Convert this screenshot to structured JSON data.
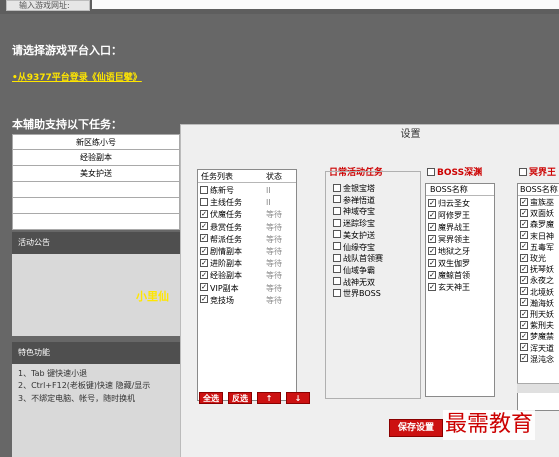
{
  "topbar": {
    "label": "输入游戏网址:"
  },
  "prompt": "请选择游戏平台入口：",
  "platform_link": "•从9377平台登录《仙语巨擘》",
  "support_title": "本辅助支持以下任务：",
  "tasks_table": [
    "新区练小号",
    "经验副本",
    "美女护送",
    "",
    "",
    ""
  ],
  "notice": {
    "header": "活动公告",
    "text": "小里仙"
  },
  "features": {
    "header": "特色功能",
    "items": [
      "1、Tab 键快速小退",
      "2、Ctrl+F12(老板键)快速 隐藏/显示",
      "3、不绑定电脑、帐号，随时换机"
    ]
  },
  "dialog": {
    "title": "设置",
    "task_list": {
      "headers": [
        "任务列表",
        "状态"
      ],
      "items": [
        {
          "label": "练新号",
          "checked": false,
          "status": "II"
        },
        {
          "label": "主线任务",
          "checked": false,
          "status": "II"
        },
        {
          "label": "伏魔任务",
          "checked": true,
          "status": "等待"
        },
        {
          "label": "悬赏任务",
          "checked": true,
          "status": "等待"
        },
        {
          "label": "帮派任务",
          "checked": true,
          "status": "等待"
        },
        {
          "label": "剧情副本",
          "checked": true,
          "status": "等待"
        },
        {
          "label": "进阶副本",
          "checked": true,
          "status": "等待"
        },
        {
          "label": "经验副本",
          "checked": true,
          "status": "等待"
        },
        {
          "label": "VIP副本",
          "checked": true,
          "status": "等待"
        },
        {
          "label": "竞技场",
          "checked": true,
          "status": "等待"
        }
      ],
      "buttons": {
        "select_all": "全选",
        "invert": "反选",
        "up": "↑",
        "down": "↓"
      }
    },
    "daily": {
      "title": "日常活动任务",
      "items": [
        "金银宝塔",
        "参禅悟道",
        "神域夺宝",
        "迷踪珍宝",
        "美女护送",
        "仙缘夺宝",
        "战队首领赛",
        "仙域争霸",
        "战神无双",
        "世界BOSS"
      ]
    },
    "boss": {
      "title": "BOSS深渊",
      "header": "BOSS名称",
      "items": [
        "归云圣女",
        "阿修罗王",
        "魔界战王",
        "冥界领主",
        "地狱之牙",
        "双生伽罗",
        "魔鲸首领",
        "玄天神王"
      ]
    },
    "hell": {
      "title": "冥界王",
      "header": "BOSS名称",
      "items": [
        "蛮族巫",
        "双面妖",
        "森罗魔",
        "末日神",
        "五毒军",
        "玫光",
        "抚琴妖",
        "永夜之",
        "北境妖",
        "瀚海妖",
        "刑天妖",
        "紫刑夫",
        "梦魔禁",
        "浑天道",
        "混沌念"
      ]
    },
    "save_button": "保存设置",
    "watermark": "最需教育"
  }
}
